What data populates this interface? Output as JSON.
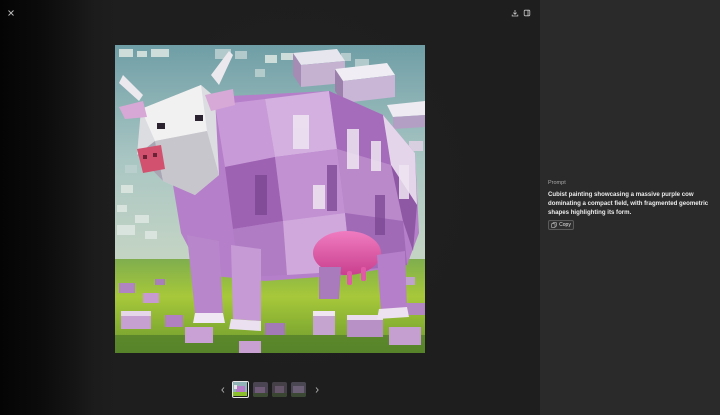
{
  "prompt": {
    "label": "Prompt",
    "text": "Cubist painting showcasing a massive purple cow dominating a compact field, with fragmented geometric shapes highlighting its form.",
    "copy_label": "Copy"
  },
  "icons": {
    "close": "close-icon",
    "download": "download-icon",
    "info": "panel-toggle-icon",
    "prev": "chevron-left-icon",
    "next": "chevron-right-icon",
    "copy": "copy-icon"
  },
  "colors": {
    "panel_bg": "#2a2a2a",
    "viewer_bg": "#1e1e1e",
    "cow_purple": "#b77cc8",
    "udder_pink": "#e05aa6",
    "grass_green": "#8cbf2c",
    "sky_teal": "#8fb3b6"
  },
  "thumbnails": [
    "thumbnail-1",
    "thumbnail-2",
    "thumbnail-3",
    "thumbnail-4"
  ]
}
